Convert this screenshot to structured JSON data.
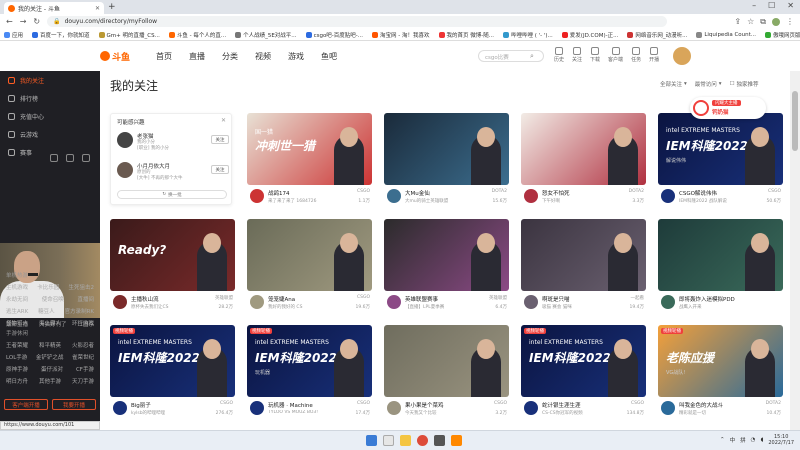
{
  "browser": {
    "tab_title": "我的关注 - 斗鱼",
    "url": "douyu.com/directory/myFollow",
    "bookmarks": [
      "应用",
      "百度一下，你就知道",
      "Gm+ 明的直播_CS...",
      "斗鱼 - 每个人的直...",
      "个人战绩_5E对战平...",
      "csgo吧-百度贴吧-...",
      "淘宝网 - 淘！我喜欢",
      "我的首页 微博-随...",
      "哔哩哔哩 ( '- ')...",
      "爱发(JD.COM)-正...",
      "网络音乐网_动漫听...",
      "Liquipedia Count...",
      "傲哦网页版"
    ]
  },
  "site": {
    "logo_text": "斗鱼",
    "nav": [
      "首页",
      "直播",
      "分类",
      "视频",
      "游戏",
      "鱼吧"
    ],
    "search_placeholder": "csgo比赛",
    "user_icons": [
      "历史",
      "关注",
      "下载",
      "客户端",
      "任务",
      "开播"
    ]
  },
  "sidebar": {
    "items": [
      {
        "label": "我的关注",
        "active": true
      },
      {
        "label": "排行榜",
        "active": false
      },
      {
        "label": "充值中心",
        "active": false
      },
      {
        "label": "云游戏",
        "active": false
      },
      {
        "label": "赛事",
        "active": false
      }
    ],
    "webcam_caption": [
      "最新主播",
      "天猫好刊了",
      "三国杀"
    ],
    "section1_title": "单机热游",
    "section1_rows": [
      [
        "主机游戏",
        "卡比乐园",
        "生死狙击2"
      ],
      [
        "永劫无间",
        "使命召唤",
        "直播间"
      ],
      [
        "逃生ARK",
        "糖豆人",
        "官方录制RK"
      ],
      [
        "怪物猎人",
        "海上霸人",
        "环行游戏"
      ]
    ],
    "section2_title": "手游休闲",
    "section2_rows": [
      [
        "王者荣耀",
        "和平精英",
        "火影忍者"
      ],
      [
        "LOL手游",
        "金铲铲之战",
        "雀荣世纪"
      ],
      [
        "原神手游",
        "蛋仔派对",
        "CF手游"
      ],
      [
        "明日方舟",
        "其他手游",
        "天刀手游"
      ]
    ],
    "buttons": [
      "客户端开播",
      "我要开播"
    ],
    "status_url": "https://www.douyu.com/101"
  },
  "main": {
    "title": "我的关注",
    "sort": [
      "全部关注",
      "最常访问",
      "独家推荐"
    ],
    "follow_card": {
      "title": "可能感兴趣",
      "rows": [
        {
          "name": "老张猫",
          "sub": "我的小分",
          "sub2": "[职业] 我的小分",
          "btn": "关注"
        },
        {
          "name": "小月月依大月",
          "sub": "原创的",
          "sub2": "[大牛] 不再的那个大牛",
          "btn": "关注"
        }
      ],
      "refresh": "换一批"
    },
    "live_badge": {
      "tag": "闪耀大主播",
      "name": "钙奶猫"
    },
    "cards": [
      {
        "title": "战鸽174",
        "sub": "来了来了来了 1684726",
        "cat": "CSGO",
        "hot": "1.1万",
        "thumb": {
          "t0": "国一猎",
          "t1": "冲刺世一猎",
          "t2": "",
          "bn": ""
        },
        "colors": [
          "#e8e1d5",
          "#c33"
        ]
      },
      {
        "title": "大Mu金仙",
        "sub": "大mu的骑士英雄联盟",
        "cat": "DOTA2",
        "hot": "15.6万",
        "thumb": {
          "t0": "",
          "t1": "",
          "t2": "",
          "bn": ""
        },
        "colors": [
          "#1a2a3a",
          "#3c6e8f"
        ]
      },
      {
        "title": "怒女不怕死",
        "sub": "下午好啊",
        "cat": "DOTA2",
        "hot": "3.3万",
        "thumb": {
          "t0": "",
          "t1": "",
          "t2": "",
          "bn": ""
        },
        "colors": [
          "#f2ece6",
          "#b03040"
        ]
      },
      {
        "title": "CSGO解说伟伟",
        "sub": "IEM科隆2022 战队解说",
        "cat": "CSGO",
        "hot": "50.6万",
        "thumb": {
          "t0": "intel EXTREME MASTERS",
          "t1": "IEM科隆2022",
          "t2": "解说伟伟",
          "bn": ""
        },
        "colors": [
          "#0b1440",
          "#18307a"
        ]
      },
      {
        "title": "主播秋山流",
        "sub": "原杯失去我们让CS",
        "cat": "英雄联盟",
        "hot": "28.2万",
        "thumb": {
          "t0": "",
          "t1": "Ready?",
          "t2": "",
          "bn": ""
        },
        "colors": [
          "#3a1a1a",
          "#7a2a2a"
        ]
      },
      {
        "title": "笼笼婕Ana",
        "sub": "我好的我好的 CS",
        "cat": "CSGO",
        "hot": "19.6万",
        "thumb": {
          "t0": "",
          "t1": "",
          "t2": "",
          "bn": ""
        },
        "colors": [
          "#6a6b58",
          "#a09a80"
        ]
      },
      {
        "title": "英雄联盟赛事",
        "sub": "【直播】LPL夏季赛",
        "cat": "英雄联盟",
        "hot": "6.4万",
        "thumb": {
          "t0": "",
          "t1": "",
          "t2": "",
          "bn": ""
        },
        "colors": [
          "#2b2b2b",
          "#8c4a86"
        ]
      },
      {
        "title": "啊斑是只喵",
        "sub": "吸猫 赛会 猫咪",
        "cat": "一起看",
        "hot": "19.4万",
        "thumb": {
          "t0": "",
          "t1": "",
          "t2": "",
          "bn": ""
        },
        "colors": [
          "#3b3440",
          "#6a6070"
        ]
      },
      {
        "title": "即将轰炸入迷模拟PDD",
        "sub": "战鹰入开来",
        "cat": "",
        "hot": "",
        "thumb": {
          "t0": "",
          "t1": "",
          "t2": "",
          "bn": ""
        },
        "colors": [
          "#1e3b3a",
          "#3a6a5a"
        ]
      },
      {
        "title": "Big丽子",
        "sub": "kylsb的哔哩哔哩",
        "cat": "CSGO",
        "hot": "276.4万",
        "thumb": {
          "t0": "intel EXTREME MASTERS",
          "t1": "IEM科隆2022",
          "t2": "",
          "bn": "视频轮播"
        },
        "colors": [
          "#0b1440",
          "#18307a"
        ]
      },
      {
        "title": "玩机器 · Machine",
        "sub": "TYLOO VS MOUZ BO3!",
        "cat": "CSGO",
        "hot": "17.4万",
        "thumb": {
          "t0": "intel EXTREME MASTERS",
          "t1": "IEM科隆2022",
          "t2": "玩机器",
          "bn": "视频轮播"
        },
        "colors": [
          "#0b1440",
          "#18307a"
        ]
      },
      {
        "title": "果小果是个菜鸡",
        "sub": "今天我又个比较",
        "cat": "CSGO",
        "hot": "3.2万",
        "thumb": {
          "t0": "",
          "t1": "",
          "t2": "",
          "bn": ""
        },
        "colors": [
          "#6f6d5e",
          "#9a9480"
        ]
      },
      {
        "title": "蛇计银生涯生涯",
        "sub": "CS-CS你冠军的视频",
        "cat": "CSGO",
        "hot": "134.8万",
        "thumb": {
          "t0": "intel EXTREME MASTERS",
          "t1": "IEM科隆2022",
          "t2": "",
          "bn": "视频轮播"
        },
        "colors": [
          "#0b1440",
          "#18307a"
        ]
      },
      {
        "title": "叫我金色的大战斗",
        "sub": "精彩就是一切",
        "cat": "DOTA2",
        "hot": "10.4万",
        "thumb": {
          "t0": "",
          "t1": "老陈应援",
          "t2": "VG战队!",
          "bn": "视频轮播"
        },
        "colors": [
          "#f4a03a",
          "#2a6a9a"
        ]
      }
    ]
  },
  "taskbar": {
    "lang": "中",
    "ime": "拼",
    "time": "15:10",
    "date": "2022/7/17"
  }
}
